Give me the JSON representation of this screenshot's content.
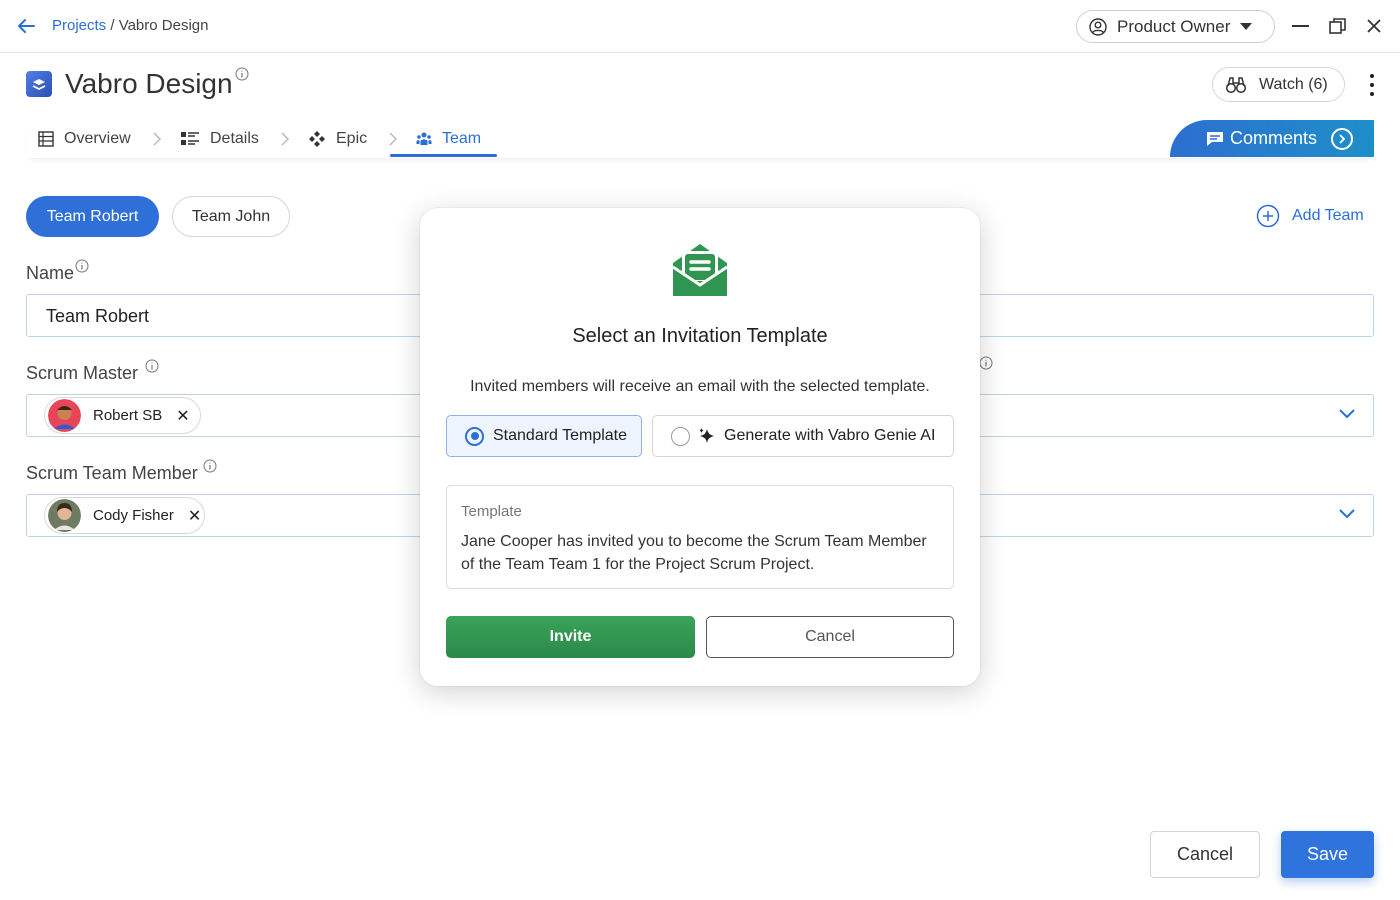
{
  "breadcrumb": {
    "projects_link": "Projects",
    "separator": " / ",
    "current": "Vabro Design"
  },
  "role_selector": {
    "value": "Product Owner"
  },
  "header": {
    "title": "Vabro Design",
    "watch_label": "Watch (6)"
  },
  "tabs": [
    {
      "label": "Overview",
      "active": false
    },
    {
      "label": "Details",
      "active": false
    },
    {
      "label": "Epic",
      "active": false
    },
    {
      "label": "Team",
      "active": true
    }
  ],
  "comments_label": "Comments",
  "teams": {
    "items": [
      "Team Robert",
      "Team John"
    ],
    "selected": "Team Robert",
    "add_label": "Add Team"
  },
  "form": {
    "name_label": "Name",
    "name_value": "Team Robert",
    "scrum_master_label": "Scrum Master",
    "scrum_master_value": "Robert SB",
    "team_member_label": "Scrum Team Member",
    "team_member_value": "Cody Fisher"
  },
  "modal": {
    "title": "Select an Invitation Template",
    "description": "Invited members will receive an email with the selected template.",
    "option_standard": "Standard Template",
    "option_ai": "Generate with Vabro Genie AI",
    "selected_option": "Standard Template",
    "template_label": "Template",
    "template_text": "Jane Cooper has invited you to become the Scrum Team Member of the Team Team 1 for the Project Scrum Project.",
    "invite_label": "Invite",
    "cancel_label": "Cancel"
  },
  "footer": {
    "cancel_label": "Cancel",
    "save_label": "Save"
  },
  "colors": {
    "accent": "#2f6fd8",
    "invite_green": "#2f9550",
    "link_blue": "#2a6fd6"
  }
}
